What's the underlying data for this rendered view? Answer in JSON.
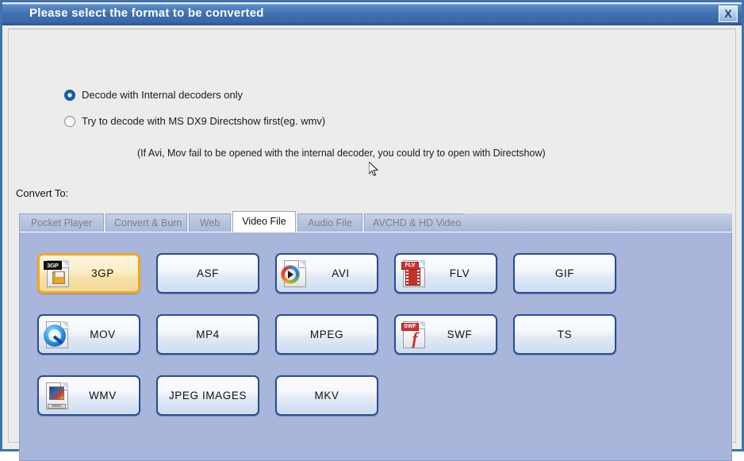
{
  "window": {
    "title": "Please select the format to be converted",
    "close_label": "X"
  },
  "decoder_options": [
    {
      "label": "Decode with Internal decoders only",
      "checked": true
    },
    {
      "label": "Try to decode with MS DX9 Directshow first(eg. wmv)",
      "checked": false
    }
  ],
  "hint": "(If Avi, Mov fail to be opened with the internal decoder, you could try to open with Directshow)",
  "convert_to_label": "Convert To:",
  "tabs": [
    {
      "label": "Pocket  Player",
      "active": false
    },
    {
      "label": "Convert & Burn",
      "active": false
    },
    {
      "label": "Web",
      "active": false
    },
    {
      "label": "Video   File",
      "active": true
    },
    {
      "label": "Audio   File",
      "active": false
    },
    {
      "label": "AVCHD & HD Video",
      "active": false
    }
  ],
  "formats": [
    [
      {
        "label": "3GP",
        "icon": "3gp-file-icon",
        "selected": true
      },
      {
        "label": "ASF",
        "icon": "",
        "selected": false
      },
      {
        "label": "AVI",
        "icon": "avi-media-player-icon",
        "selected": false
      },
      {
        "label": "FLV",
        "icon": "flv-filmstrip-icon",
        "selected": false
      },
      {
        "label": "GIF",
        "icon": "",
        "selected": false
      }
    ],
    [
      {
        "label": "MOV",
        "icon": "mov-quicktime-icon",
        "selected": false
      },
      {
        "label": "MP4",
        "icon": "",
        "selected": false
      },
      {
        "label": "MPEG",
        "icon": "",
        "selected": false
      },
      {
        "label": "SWF",
        "icon": "swf-flash-icon",
        "selected": false
      },
      {
        "label": "TS",
        "icon": "",
        "selected": false
      }
    ],
    [
      {
        "label": "WMV",
        "icon": "wmv-file-icon",
        "selected": false
      },
      {
        "label": "JPEG IMAGES",
        "icon": "",
        "selected": false
      },
      {
        "label": "MKV",
        "icon": "",
        "selected": false
      }
    ]
  ],
  "icon_text": {
    "badge_3gp": "3GP",
    "badge_flv": "FLV",
    "badge_swf": "SWF",
    "flash_glyph": "f",
    "wmv_caption": "WMV"
  },
  "colors": {
    "titlebar": "#3f6fae",
    "panel": "#a8b6dc",
    "selected_border": "#f0a81e",
    "button_border": "#2a4d8f"
  }
}
